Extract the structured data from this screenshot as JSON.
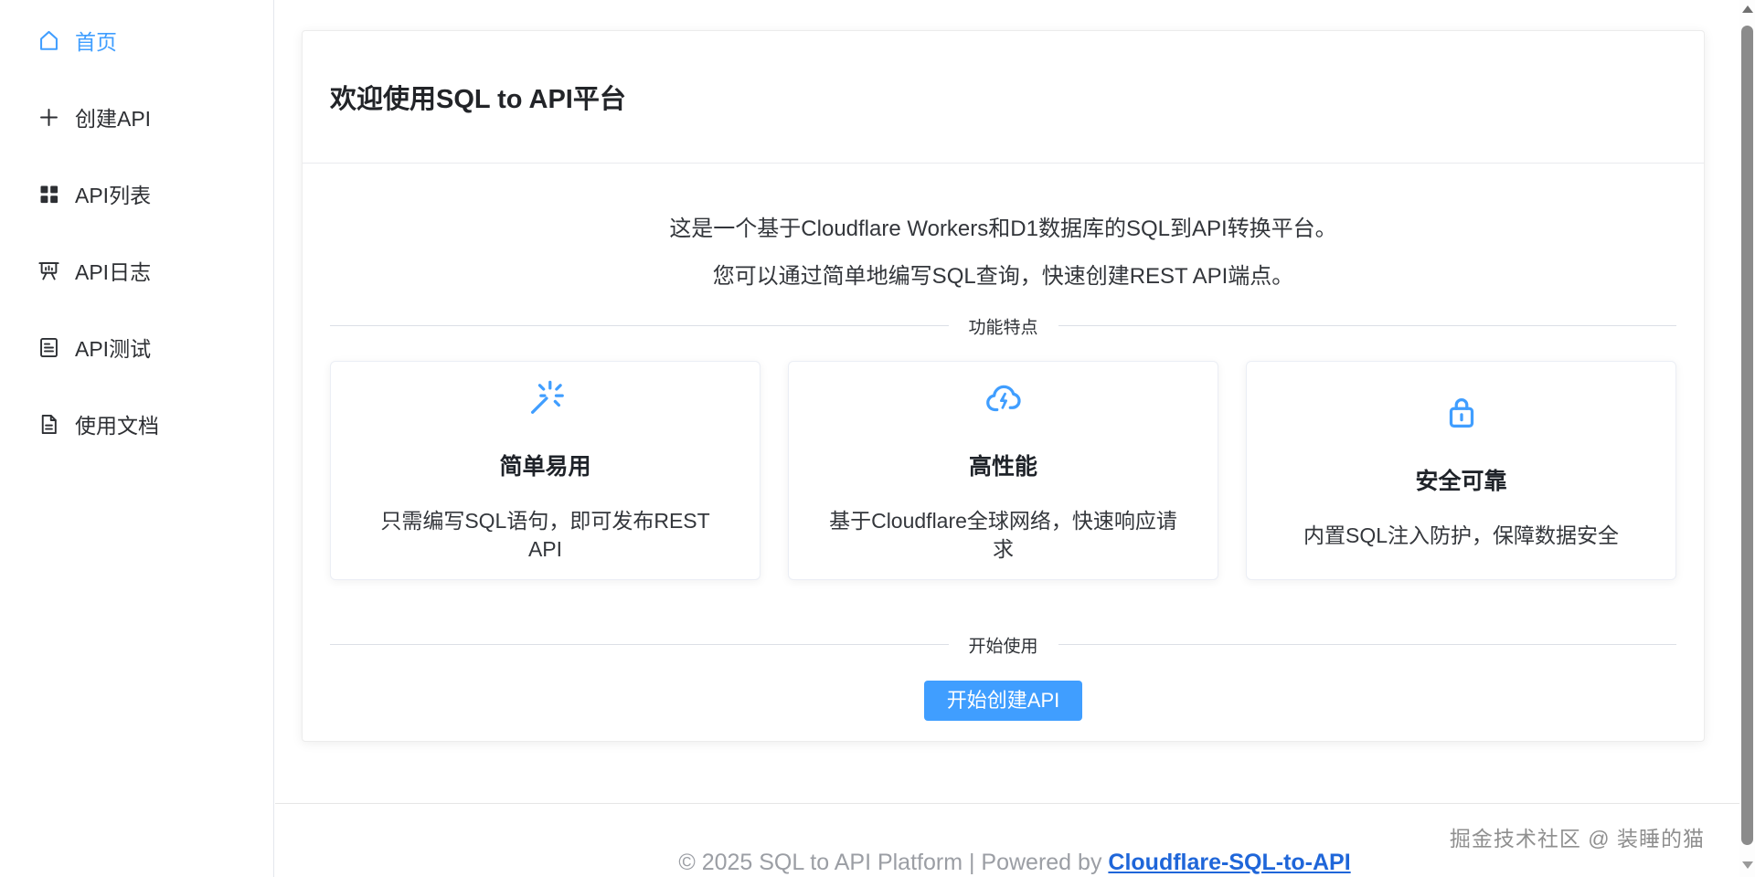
{
  "colors": {
    "accent": "#409eff",
    "link": "#1f66d9"
  },
  "sidebar": {
    "items": [
      {
        "label": "首页",
        "icon": "home-icon",
        "active": true
      },
      {
        "label": "创建API",
        "icon": "plus-icon",
        "active": false
      },
      {
        "label": "API列表",
        "icon": "grid-icon",
        "active": false
      },
      {
        "label": "API日志",
        "icon": "data-board-icon",
        "active": false
      },
      {
        "label": "API测试",
        "icon": "document-lines-icon",
        "active": false
      },
      {
        "label": "使用文档",
        "icon": "file-icon",
        "active": false
      }
    ]
  },
  "main": {
    "card_title": "欢迎使用SQL to API平台",
    "intro_line1": "这是一个基于Cloudflare Workers和D1数据库的SQL到API转换平台。",
    "intro_line2": "您可以通过简单地编写SQL查询，快速创建REST API端点。",
    "features_divider_label": "功能特点",
    "features": [
      {
        "icon": "magic-stick-icon",
        "title": "简单易用",
        "description": "只需编写SQL语句，即可发布REST API"
      },
      {
        "icon": "cloud-lightning-icon",
        "title": "高性能",
        "description": "基于Cloudflare全球网络，快速响应请求"
      },
      {
        "icon": "lock-icon",
        "title": "安全可靠",
        "description": "内置SQL注入防护，保障数据安全"
      }
    ],
    "start_divider_label": "开始使用",
    "start_button_label": "开始创建API"
  },
  "footer": {
    "copyright_text": "© 2025 SQL to API Platform | Powered by",
    "link_label": "Cloudflare-SQL-to-API"
  },
  "watermark_text": "掘金技术社区 @ 装睡的猫"
}
